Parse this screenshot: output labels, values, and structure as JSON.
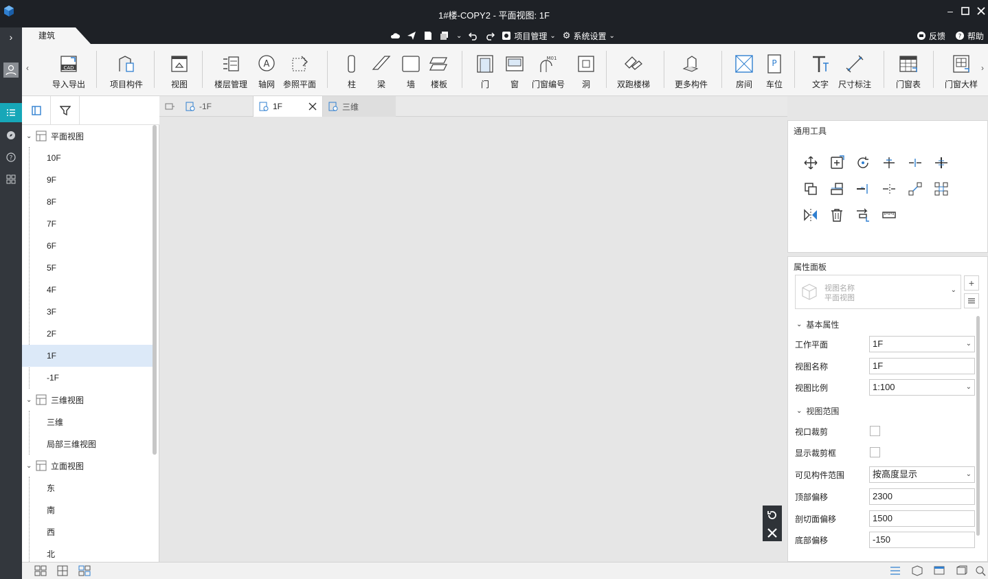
{
  "window": {
    "title": "1#楼-COPY2 - 平面视图: 1F"
  },
  "quickbar": {
    "ribbon_tab": "建筑",
    "project_menu": "项目管理",
    "settings_menu": "系统设置",
    "feedback": "反馈",
    "help": "帮助"
  },
  "ribbon": {
    "items": [
      {
        "label": "导入导出",
        "icon": "cad-import-icon"
      },
      {
        "label": "项目构件",
        "icon": "project-component-icon"
      },
      {
        "label": "视图",
        "icon": "view-icon"
      },
      {
        "label": "楼层管理",
        "icon": "floor-management-icon"
      },
      {
        "label": "轴网",
        "icon": "axis-grid-icon"
      },
      {
        "label": "参照平面",
        "icon": "reference-plane-icon"
      },
      {
        "label": "柱",
        "icon": "column-icon"
      },
      {
        "label": "梁",
        "icon": "beam-icon"
      },
      {
        "label": "墙",
        "icon": "wall-icon"
      },
      {
        "label": "楼板",
        "icon": "slab-icon"
      },
      {
        "label": "门",
        "icon": "door-icon"
      },
      {
        "label": "窗",
        "icon": "window-icon"
      },
      {
        "label": "门窗编号",
        "icon": "door-window-number-icon"
      },
      {
        "label": "洞",
        "icon": "opening-icon"
      },
      {
        "label": "双跑楼梯",
        "icon": "stair-icon"
      },
      {
        "label": "更多构件",
        "icon": "more-components-icon"
      },
      {
        "label": "房间",
        "icon": "room-icon"
      },
      {
        "label": "车位",
        "icon": "parking-icon"
      },
      {
        "label": "文字",
        "icon": "text-icon"
      },
      {
        "label": "尺寸标注",
        "icon": "dimension-icon"
      },
      {
        "label": "门窗表",
        "icon": "door-window-table-icon"
      },
      {
        "label": "门窗大样",
        "icon": "door-window-detail-icon"
      }
    ]
  },
  "tree": {
    "groups": [
      {
        "label": "平面视图",
        "children": [
          "10F",
          "9F",
          "8F",
          "7F",
          "6F",
          "5F",
          "4F",
          "3F",
          "2F",
          "1F",
          "-1F"
        ]
      },
      {
        "label": "三维视图",
        "children": [
          "三维",
          "局部三维视图"
        ]
      },
      {
        "label": "立面视图",
        "children": [
          "东",
          "南",
          "西",
          "北"
        ]
      }
    ],
    "selected": "1F"
  },
  "tabs": [
    {
      "label": "-1F"
    },
    {
      "label": "1F"
    },
    {
      "label": "三维"
    }
  ],
  "tools_panel": {
    "title": "通用工具"
  },
  "properties": {
    "title": "属性面板",
    "view_type_name": "视图名称",
    "view_type_value": "平面视图",
    "section_basic": "基本属性",
    "section_range": "视图范围",
    "rows": [
      {
        "label": "工作平面",
        "value": "1F"
      },
      {
        "label": "视图名称",
        "value": "1F"
      },
      {
        "label": "视图比例",
        "value": "1:100"
      },
      {
        "label": "视口裁剪",
        "value": ""
      },
      {
        "label": "显示裁剪框",
        "value": ""
      },
      {
        "label": "可见构件范围",
        "value": "按高度显示"
      },
      {
        "label": "顶部偏移",
        "value": "2300"
      },
      {
        "label": "剖切面偏移",
        "value": "1500"
      },
      {
        "label": "底部偏移",
        "value": "-150"
      }
    ]
  },
  "colors": {
    "accent": "#17a7b8",
    "titlebar": "#1e2126",
    "selected_row": "#dce9f8",
    "icon_blue": "#2f7fd0"
  }
}
